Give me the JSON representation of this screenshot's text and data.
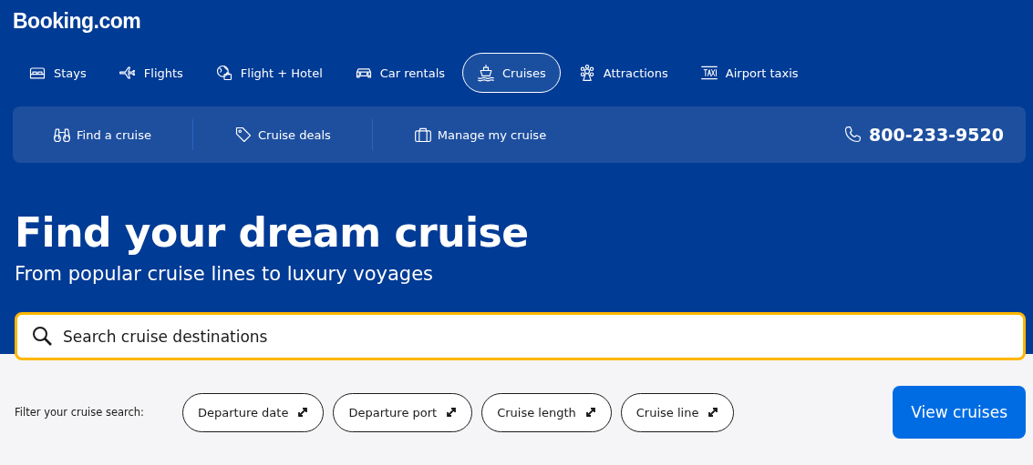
{
  "logo": "Booking.com",
  "nav": [
    {
      "label": "Stays",
      "selected": false
    },
    {
      "label": "Flights",
      "selected": false
    },
    {
      "label": "Flight + Hotel",
      "selected": false
    },
    {
      "label": "Car rentals",
      "selected": false
    },
    {
      "label": "Cruises",
      "selected": true
    },
    {
      "label": "Attractions",
      "selected": false
    },
    {
      "label": "Airport taxis",
      "selected": false
    }
  ],
  "subnav": [
    {
      "label": "Find a cruise"
    },
    {
      "label": "Cruise deals"
    },
    {
      "label": "Manage my cruise"
    }
  ],
  "phone": "800-233-9520",
  "hero": {
    "title": "Find your dream cruise",
    "subtitle": "From popular cruise lines to luxury voyages"
  },
  "search": {
    "placeholder": "Search cruise destinations"
  },
  "filters": {
    "label": "Filter your cruise search:",
    "chips": [
      "Departure date",
      "Departure port",
      "Cruise length",
      "Cruise line"
    ]
  },
  "submit": "View cruises"
}
